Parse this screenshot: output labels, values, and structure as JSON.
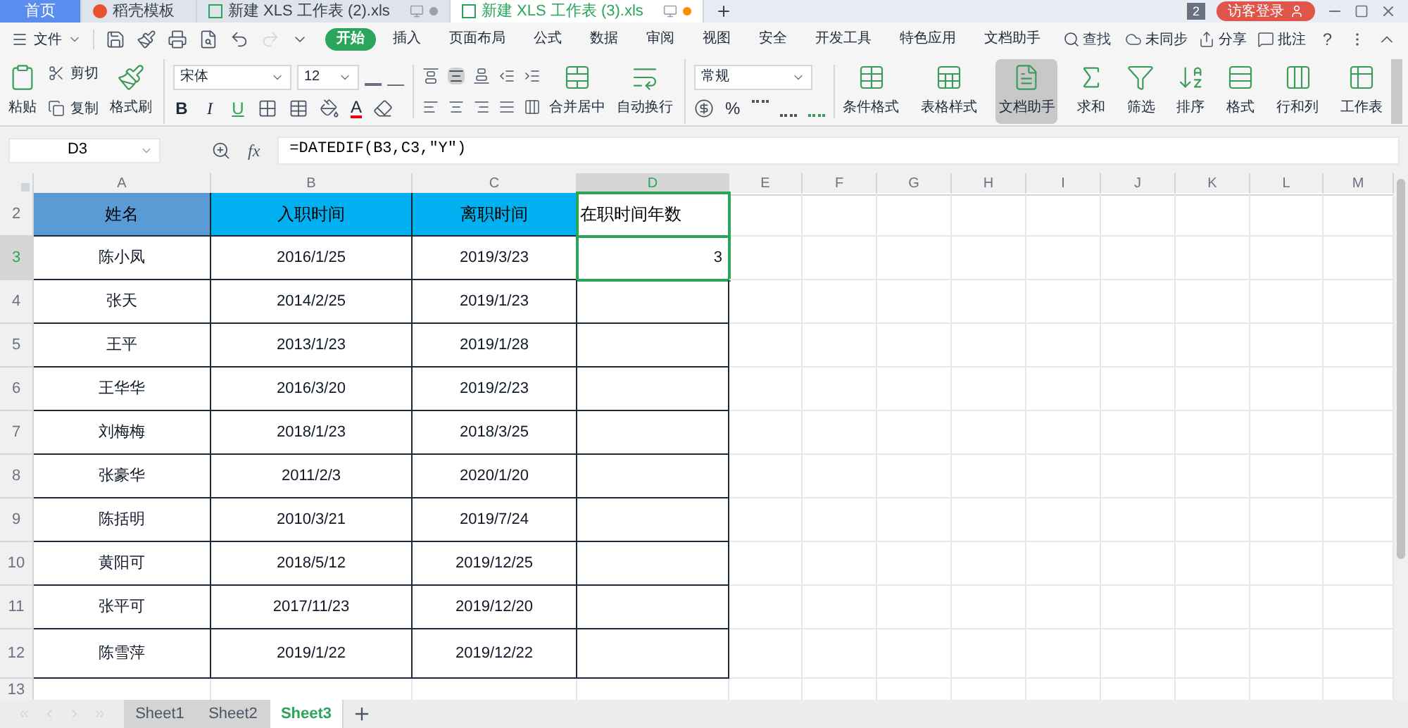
{
  "title_tabs": [
    {
      "label": "首页",
      "selected": false,
      "kind": "home"
    },
    {
      "label": "稻壳模板",
      "selected": false,
      "kind": "template"
    },
    {
      "label": "新建 XLS 工作表 (2).xls",
      "selected": false,
      "kind": "file"
    },
    {
      "label": "新建 XLS 工作表 (3).xls",
      "selected": true,
      "kind": "file"
    }
  ],
  "window_badge": "2",
  "login": "访客登录",
  "file_menu": "文件",
  "menu_tabs": [
    {
      "label": "开始",
      "selected": true
    },
    {
      "label": "插入",
      "selected": false
    },
    {
      "label": "页面布局",
      "selected": false
    },
    {
      "label": "公式",
      "selected": false
    },
    {
      "label": "数据",
      "selected": false
    },
    {
      "label": "审阅",
      "selected": false
    },
    {
      "label": "视图",
      "selected": false
    },
    {
      "label": "安全",
      "selected": false
    },
    {
      "label": "开发工具",
      "selected": false
    },
    {
      "label": "特色应用",
      "selected": false
    },
    {
      "label": "文档助手",
      "selected": false
    }
  ],
  "search": "查找",
  "right_actions": [
    "未同步",
    "分享",
    "批注"
  ],
  "help": "?",
  "clipboard": {
    "paste": "粘贴",
    "cut": "剪切",
    "copy": "复制",
    "painter": "格式刷"
  },
  "font": {
    "name": "宋体",
    "size": "12",
    "styles": [
      "B",
      "I",
      "U"
    ],
    "font_color": "A"
  },
  "alignment": {
    "merge": "合并居中",
    "wrap": "自动换行"
  },
  "number": {
    "format": "常规",
    "percent": "%"
  },
  "ribbon_buttons": [
    {
      "label": "条件格式",
      "selected": false
    },
    {
      "label": "表格样式",
      "selected": false
    },
    {
      "label": "文档助手",
      "selected": true
    },
    {
      "label": "求和",
      "selected": false
    },
    {
      "label": "筛选",
      "selected": false
    },
    {
      "label": "排序",
      "selected": false
    },
    {
      "label": "格式",
      "selected": false
    },
    {
      "label": "行和列",
      "selected": false
    },
    {
      "label": "工作表",
      "selected": false
    }
  ],
  "name_box": "D3",
  "function_label": "fx",
  "formula": "=DATEDIF(B3,C3,\"Y\")",
  "columns": [
    {
      "label": "A",
      "selected": false
    },
    {
      "label": "B",
      "selected": false
    },
    {
      "label": "C",
      "selected": false
    },
    {
      "label": "D",
      "selected": true
    },
    {
      "label": "E",
      "selected": false
    },
    {
      "label": "F",
      "selected": false
    },
    {
      "label": "G",
      "selected": false
    },
    {
      "label": "H",
      "selected": false
    },
    {
      "label": "I",
      "selected": false
    },
    {
      "label": "J",
      "selected": false
    },
    {
      "label": "K",
      "selected": false
    },
    {
      "label": "L",
      "selected": false
    },
    {
      "label": "M",
      "selected": false
    }
  ],
  "rows": [
    {
      "number": "2",
      "selected": false,
      "kind": "header",
      "cells": [
        {
          "text": "姓名",
          "color": "#5b9bd5"
        },
        {
          "text": "入职时间",
          "color": "#00b0f0"
        },
        {
          "text": "离职时间",
          "color": "#00b0f0"
        },
        {
          "text": "在职时间年数",
          "color": "#ffffff"
        }
      ]
    },
    {
      "number": "3",
      "selected": true,
      "kind": "data",
      "cells": [
        {
          "text": "陈小凤"
        },
        {
          "text": "2016/1/25"
        },
        {
          "text": "2019/3/23"
        },
        {
          "text": "3"
        }
      ]
    },
    {
      "number": "4",
      "selected": false,
      "kind": "data",
      "cells": [
        {
          "text": "张天"
        },
        {
          "text": "2014/2/25"
        },
        {
          "text": "2019/1/23"
        },
        {}
      ]
    },
    {
      "number": "5",
      "selected": false,
      "kind": "data",
      "cells": [
        {
          "text": "王平"
        },
        {
          "text": "2013/1/23"
        },
        {
          "text": "2019/1/28"
        },
        {}
      ]
    },
    {
      "number": "6",
      "selected": false,
      "kind": "data",
      "cells": [
        {
          "text": "王华华"
        },
        {
          "text": "2016/3/20"
        },
        {
          "text": "2019/2/23"
        },
        {}
      ]
    },
    {
      "number": "7",
      "selected": false,
      "kind": "data",
      "cells": [
        {
          "text": "刘梅梅"
        },
        {
          "text": "2018/1/23"
        },
        {
          "text": "2018/3/25"
        },
        {}
      ]
    },
    {
      "number": "8",
      "selected": false,
      "kind": "data",
      "cells": [
        {
          "text": "张豪华"
        },
        {
          "text": "2011/2/3"
        },
        {
          "text": "2020/1/20"
        },
        {}
      ]
    },
    {
      "number": "9",
      "selected": false,
      "kind": "data",
      "cells": [
        {
          "text": "陈括明"
        },
        {
          "text": "2010/3/21"
        },
        {
          "text": "2019/7/24"
        },
        {}
      ]
    },
    {
      "number": "10",
      "selected": false,
      "kind": "data",
      "cells": [
        {
          "text": "黄阳可"
        },
        {
          "text": "2018/5/12"
        },
        {
          "text": "2019/12/25"
        },
        {}
      ]
    },
    {
      "number": "11",
      "selected": false,
      "kind": "data",
      "cells": [
        {
          "text": "张平可"
        },
        {
          "text": "2017/11/23"
        },
        {
          "text": "2019/12/20"
        },
        {}
      ]
    },
    {
      "number": "12",
      "selected": false,
      "kind": "data",
      "cells": [
        {
          "text": "陈雪萍"
        },
        {
          "text": "2019/1/22"
        },
        {
          "text": "2019/12/22"
        },
        {}
      ]
    },
    {
      "number": "13",
      "selected": false,
      "kind": "blank",
      "cells": []
    }
  ],
  "sheets": [
    {
      "label": "Sheet1",
      "selected": false
    },
    {
      "label": "Sheet2",
      "selected": false
    },
    {
      "label": "Sheet3",
      "selected": true
    }
  ]
}
